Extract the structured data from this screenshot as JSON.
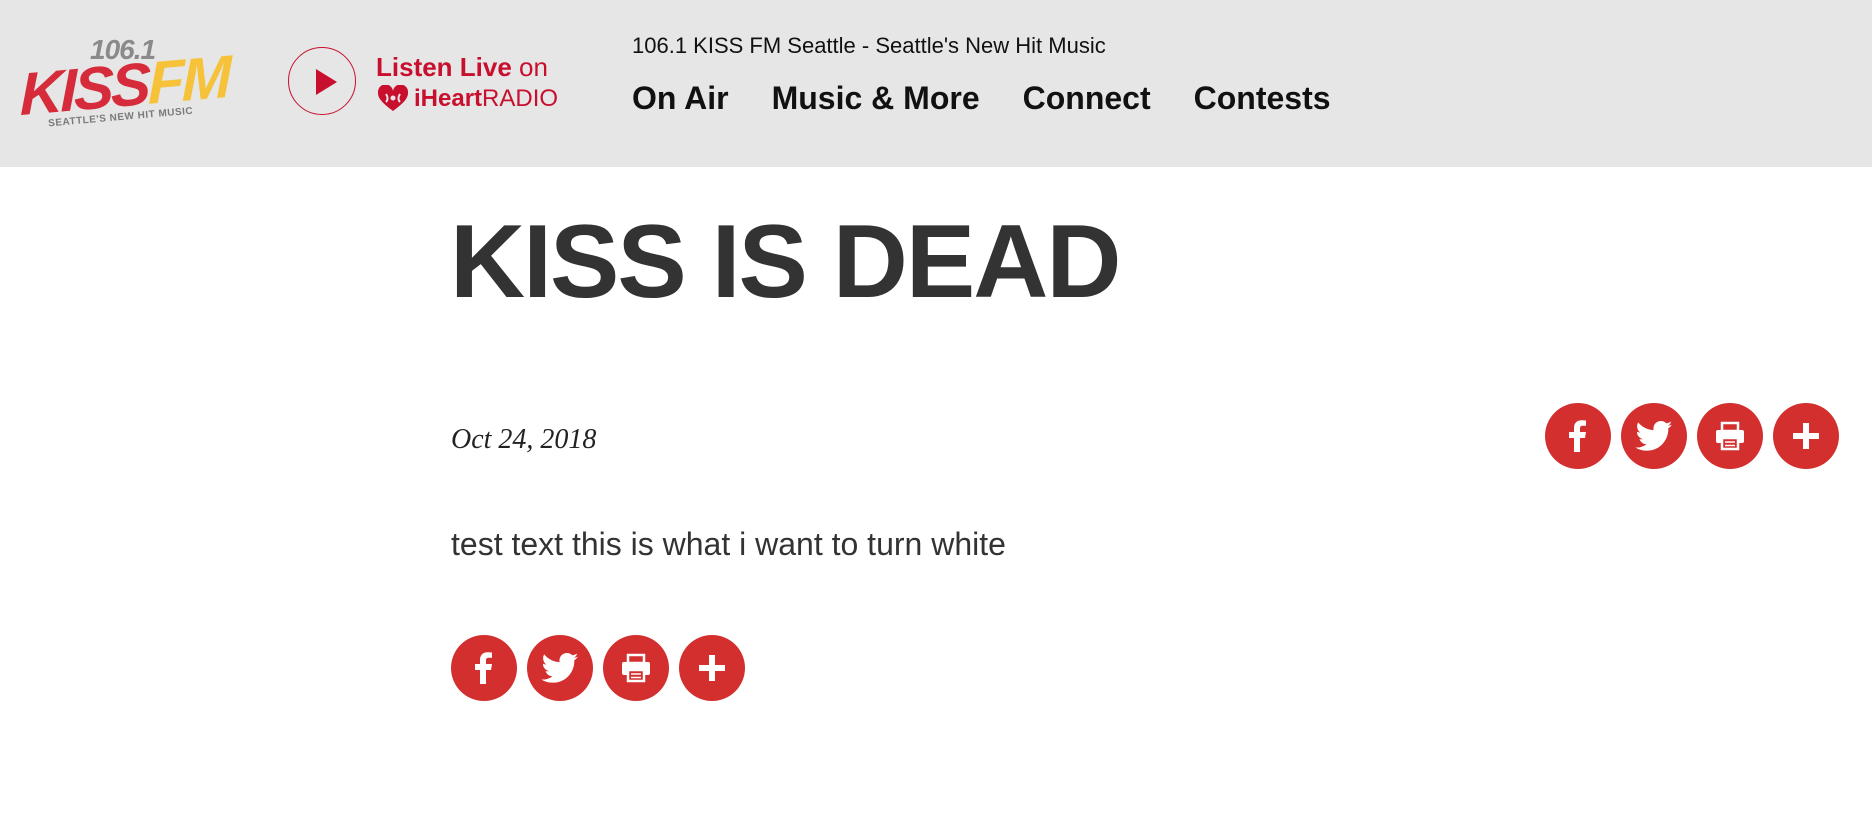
{
  "header": {
    "logo": {
      "frequency": "106.1",
      "brand_kiss": "KISS",
      "brand_fm": "FM",
      "tagline": "SEATTLE'S NEW HIT MUSIC"
    },
    "listen_live": {
      "word_listen": "Listen Live",
      "word_on": " on",
      "iheart": "iHeart",
      "radio": "RADIO"
    },
    "station_tagline": "106.1 KISS FM Seattle - Seattle's New Hit Music",
    "nav": [
      "On Air",
      "Music & More",
      "Connect",
      "Contests"
    ]
  },
  "article": {
    "title": "KISS IS DEAD",
    "date": "Oct 24, 2018",
    "body": "test text this is what i want to turn white"
  },
  "share_icons": [
    "facebook-icon",
    "twitter-icon",
    "print-icon",
    "plus-icon"
  ],
  "colors": {
    "header_bg": "#e6e6e6",
    "accent_red": "#c8102e",
    "share_red": "#d32f2f",
    "logo_red": "#d52b3a",
    "logo_yellow": "#f6c23a"
  }
}
